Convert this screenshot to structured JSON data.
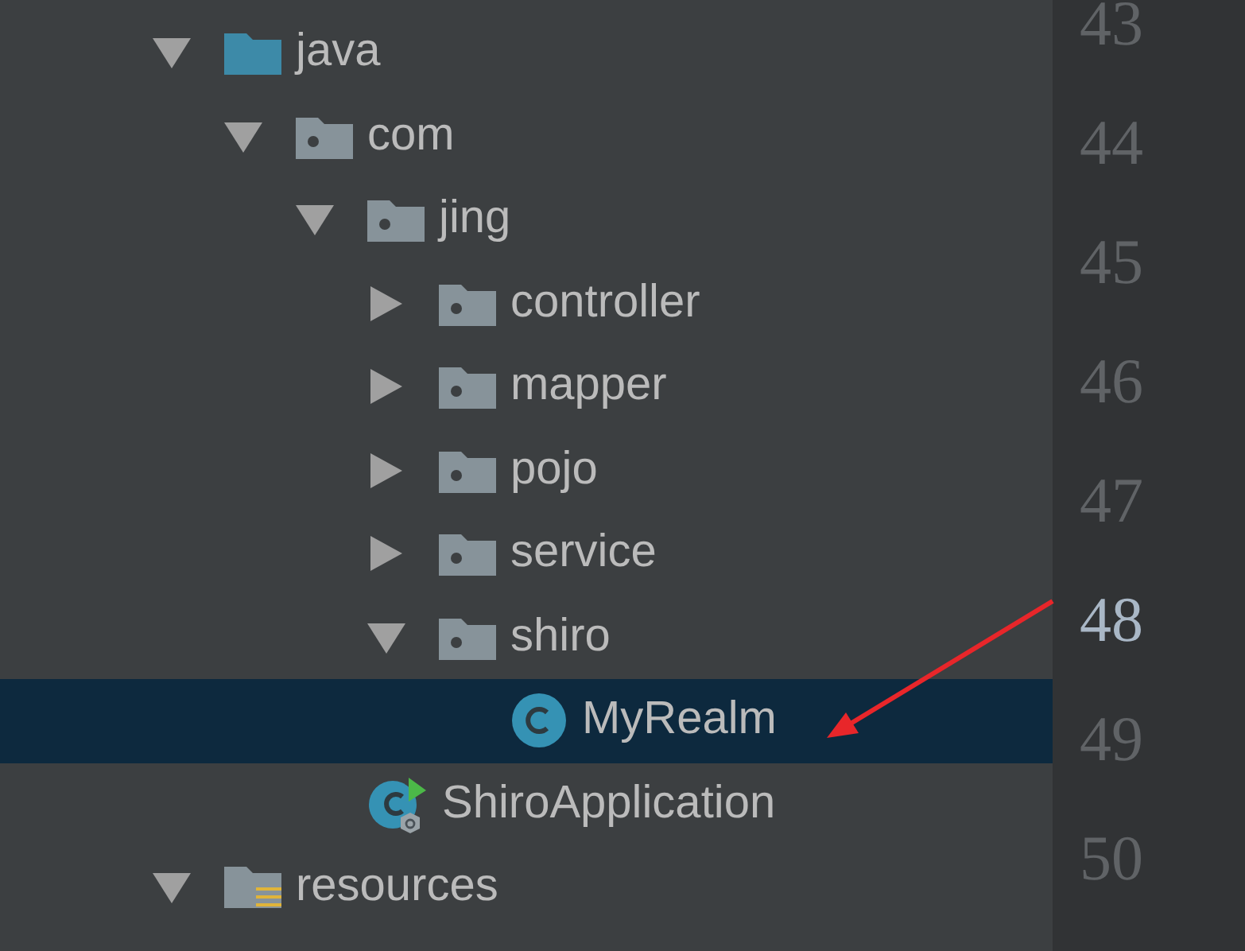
{
  "project_tree": [
    {
      "label": "java",
      "kind": "source_folder",
      "expanded": true,
      "selected": false,
      "children": [
        {
          "label": "com",
          "kind": "package",
          "expanded": true,
          "selected": false,
          "children": [
            {
              "label": "jing",
              "kind": "package",
              "expanded": true,
              "selected": false,
              "children": [
                {
                  "label": "controller",
                  "kind": "package",
                  "expanded": false,
                  "selected": false
                },
                {
                  "label": "mapper",
                  "kind": "package",
                  "expanded": false,
                  "selected": false
                },
                {
                  "label": "pojo",
                  "kind": "package",
                  "expanded": false,
                  "selected": false
                },
                {
                  "label": "service",
                  "kind": "package",
                  "expanded": false,
                  "selected": false
                },
                {
                  "label": "shiro",
                  "kind": "package",
                  "expanded": true,
                  "selected": false,
                  "children": [
                    {
                      "label": "MyRealm",
                      "kind": "class",
                      "selected": true
                    }
                  ]
                }
              ]
            },
            {
              "label": "ShiroApplication",
              "kind": "spring_app",
              "selected": false
            }
          ]
        }
      ]
    },
    {
      "label": "resources",
      "kind": "resources",
      "expanded": true,
      "selected": false
    }
  ],
  "gutter": {
    "line_numbers": [
      {
        "label": "43",
        "current": false
      },
      {
        "label": "44",
        "current": false
      },
      {
        "label": "45",
        "current": false
      },
      {
        "label": "46",
        "current": false
      },
      {
        "label": "47",
        "current": false
      },
      {
        "label": "48",
        "current": true
      },
      {
        "label": "49",
        "current": false
      },
      {
        "label": "50",
        "current": false
      }
    ]
  }
}
